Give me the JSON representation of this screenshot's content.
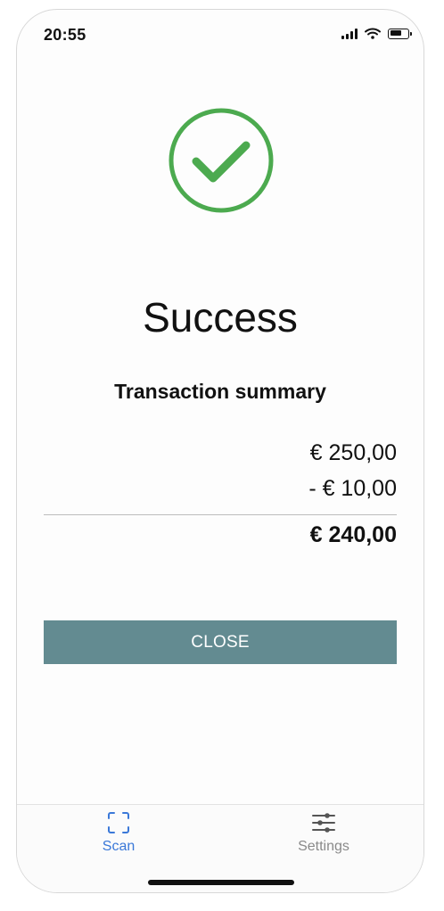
{
  "status_bar": {
    "time": "20:55"
  },
  "result": {
    "title": "Success",
    "icon": "check-circle-icon",
    "icon_color": "#4caa4f"
  },
  "summary": {
    "heading": "Transaction summary",
    "amount": "€ 250,00",
    "discount": "- € 10,00",
    "total": "€ 240,00"
  },
  "actions": {
    "close_label": "CLOSE",
    "close_color": "#638b91"
  },
  "tab_bar": {
    "active_color": "#3a78d8",
    "items": [
      {
        "label": "Scan",
        "icon": "scan-icon",
        "active": true
      },
      {
        "label": "Settings",
        "icon": "sliders-icon",
        "active": false
      }
    ]
  }
}
